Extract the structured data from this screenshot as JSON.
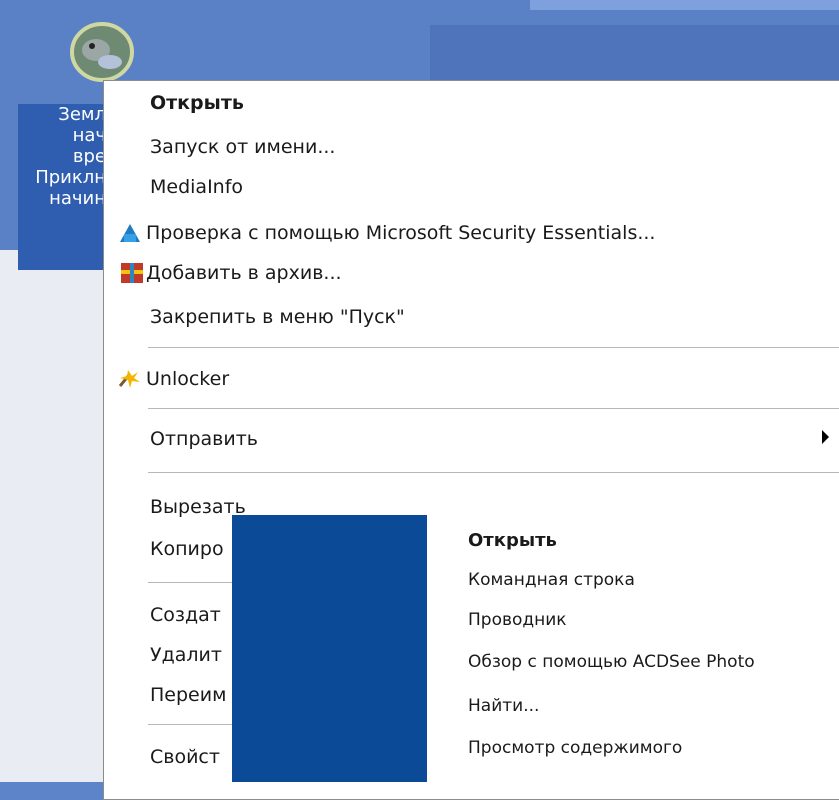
{
  "desktop": {
    "icon_label_lines": [
      "Земл",
      "нач",
      "вре",
      "Приклн",
      "начин"
    ]
  },
  "context_menu": {
    "items": [
      {
        "label": "Открыть",
        "bold": true
      },
      {
        "label": "Запуск от имени..."
      },
      {
        "label": "MediaInfo"
      },
      {
        "label": "Проверка с помощью Microsoft Security Essentials...",
        "icon": "security-essentials-icon"
      },
      {
        "label": "Добавить в архив...",
        "icon": "archive-icon"
      },
      {
        "label": "Закрепить в меню \"Пуск\""
      },
      {
        "label": "Unlocker",
        "icon": "unlocker-icon"
      },
      {
        "label": "Отправить",
        "submenu": true
      },
      {
        "label": "Вырезать"
      },
      {
        "label": "Копиро"
      },
      {
        "label": "Создат"
      },
      {
        "label": "Удалит"
      },
      {
        "label": "Переим"
      },
      {
        "label": "Свойст"
      }
    ]
  },
  "overlay_menu": {
    "items": [
      {
        "label": "Открыть",
        "bold": true
      },
      {
        "label": "Командная строка"
      },
      {
        "label": "Проводник"
      },
      {
        "label": "Обзор с помощью ACDSee Photo"
      },
      {
        "label": "Найти..."
      },
      {
        "label": "Просмотр содержимого"
      }
    ]
  }
}
